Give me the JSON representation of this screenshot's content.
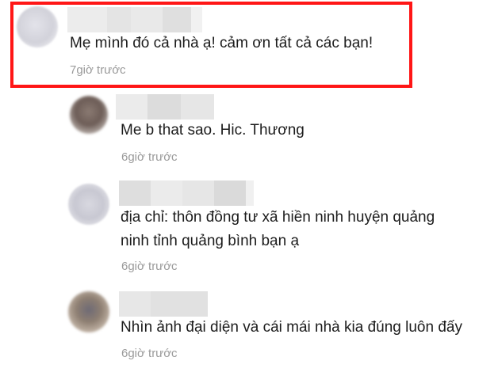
{
  "comments": [
    {
      "text_lines": [
        "Mẹ mình đó cả nhà ạ! cảm ơn tất cả các bạn!"
      ],
      "time": "7giờ trước",
      "highlighted": true
    },
    {
      "text_lines": [
        "Me b that sao. Hic. Thương"
      ],
      "time": "6giờ trước",
      "highlighted": false
    },
    {
      "text_lines": [
        "địa chỉ: thôn đồng tư xã hiền ninh huyện quảng",
        "ninh tỉnh quảng bình bạn ạ"
      ],
      "time": "6giờ trước",
      "highlighted": false
    },
    {
      "text_lines": [
        "Nhìn ảnh đại diện và cái mái nhà kia đúng luôn đấy"
      ],
      "time": "6giờ trước",
      "highlighted": false
    }
  ],
  "colors": {
    "highlight_border": "#ff1616",
    "time_text": "#9a9a9a",
    "body_text": "#1c1c1c"
  },
  "icons": {
    "avatar": "avatar-blurred",
    "name": "name-blurred"
  }
}
